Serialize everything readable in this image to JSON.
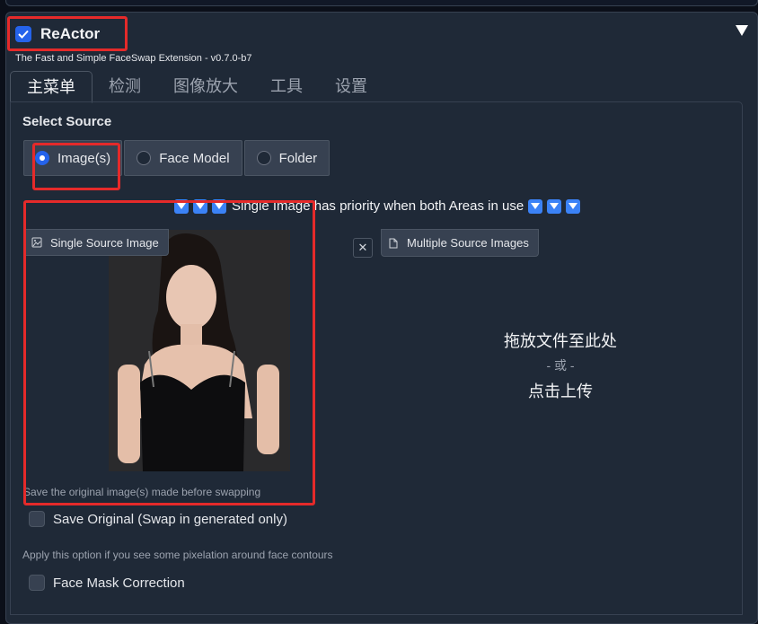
{
  "extension": {
    "title": "ReActor",
    "subtitle": "The Fast and Simple FaceSwap Extension - v0.7.0-b7",
    "enabled": true
  },
  "tabs": [
    {
      "label": "主菜单",
      "active": true
    },
    {
      "label": "检测",
      "active": false
    },
    {
      "label": "图像放大",
      "active": false
    },
    {
      "label": "工具",
      "active": false
    },
    {
      "label": "设置",
      "active": false
    }
  ],
  "source": {
    "label": "Select Source",
    "options": [
      {
        "label": "Image(s)",
        "selected": true
      },
      {
        "label": "Face Model",
        "selected": false
      },
      {
        "label": "Folder",
        "selected": false
      }
    ]
  },
  "priority_note": "Single Image has priority when both Areas in use",
  "single_image": {
    "label": "Single Source Image",
    "save_hint": "Save the original image(s) made before swapping"
  },
  "multiple_images": {
    "label": "Multiple Source Images",
    "drop_line1": "拖放文件至此处",
    "drop_or": "- 或 -",
    "drop_line2": "点击上传"
  },
  "options": {
    "save_original": "Save Original (Swap in generated only)",
    "face_mask_hint": "Apply this option if you see some pixelation around face contours",
    "face_mask": "Face Mask Correction"
  },
  "colors": {
    "accent": "#2563eb",
    "highlight_box": "#e52a2a",
    "background": "#1f2937"
  }
}
